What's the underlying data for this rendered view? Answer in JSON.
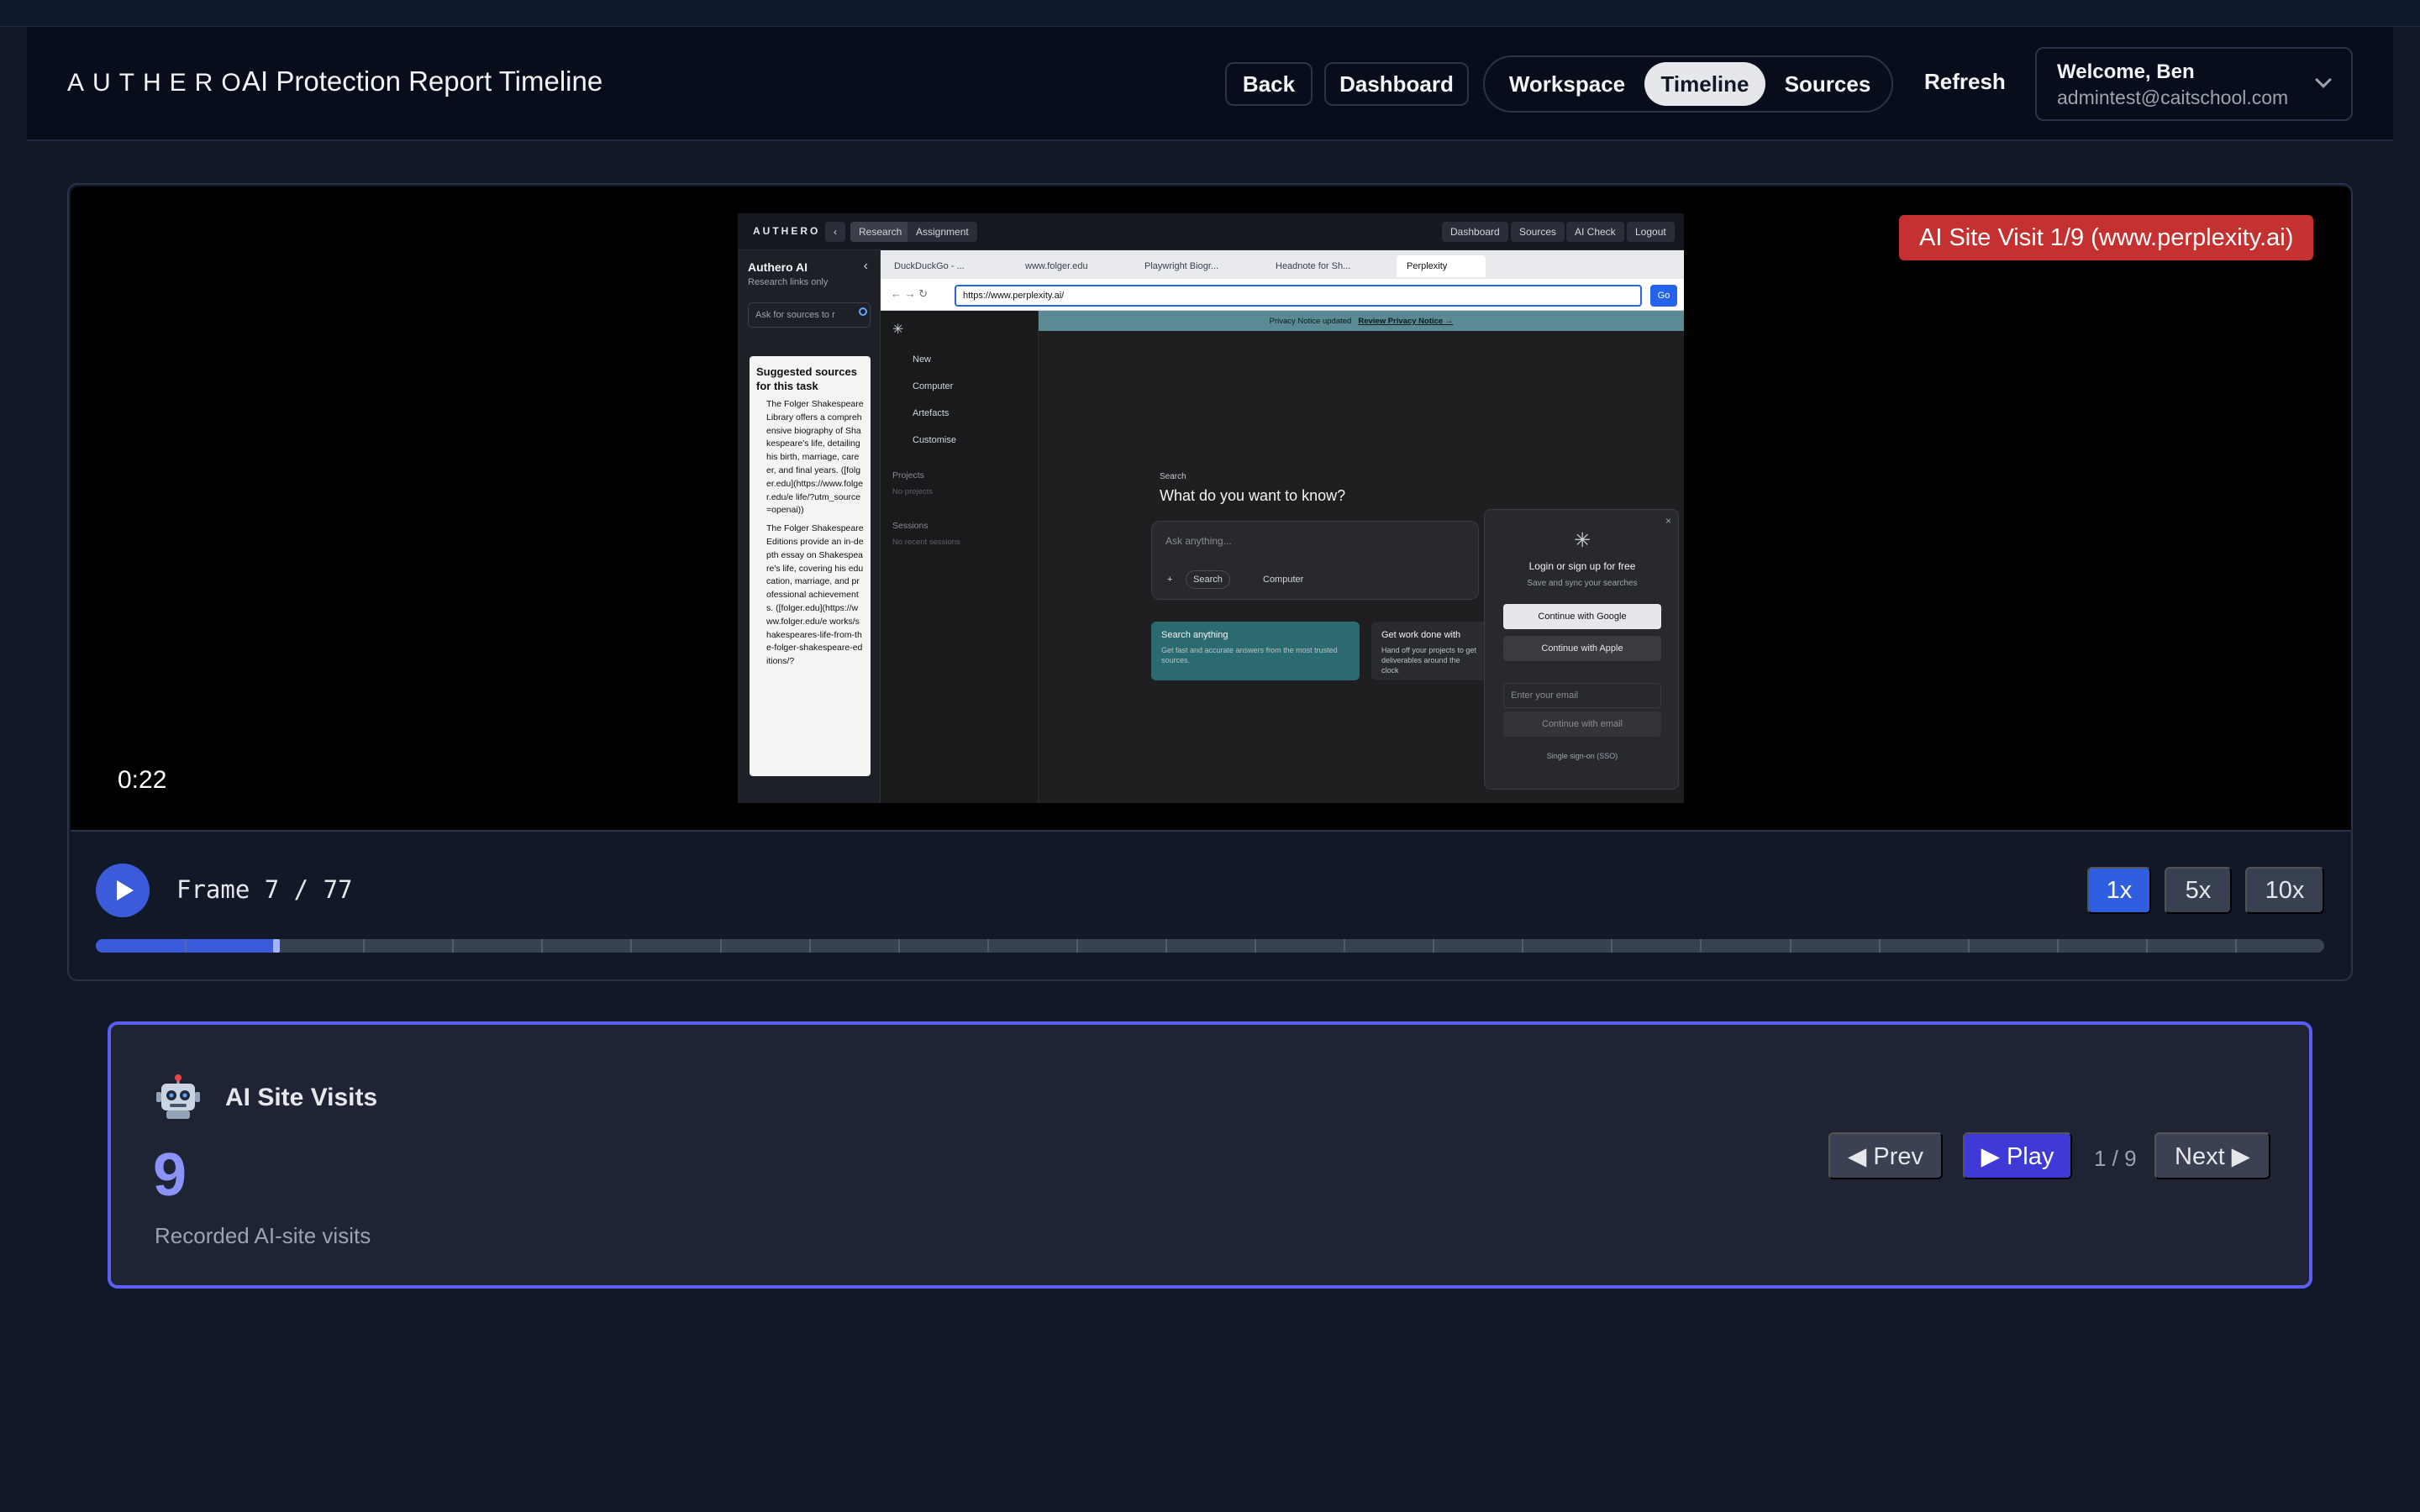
{
  "header": {
    "logo": "AUTHERO",
    "title": "AI Protection Report Timeline",
    "buttons": {
      "back": "Back",
      "dashboard": "Dashboard",
      "refresh": "Refresh"
    },
    "tabs": [
      {
        "label": "Workspace",
        "active": false
      },
      {
        "label": "Timeline",
        "active": true
      },
      {
        "label": "Sources",
        "active": false
      }
    ],
    "user": {
      "name": "Welcome, Ben",
      "email": "admintest@caitschool.com"
    }
  },
  "player": {
    "timestamp": "0:22",
    "ai_badge": "AI Site Visit 1/9 (www.perplexity.ai)",
    "frame_label": "Frame 7 / 77",
    "current_frame": 7,
    "total_frames": 77,
    "speeds": [
      {
        "label": "1x",
        "active": true
      },
      {
        "label": "5x",
        "active": false
      },
      {
        "label": "10x",
        "active": false
      }
    ],
    "colors": {
      "accent": "#3b5bdb",
      "badge": "#c53030"
    }
  },
  "screenshot": {
    "logo": "AUTHERO",
    "top_chips": [
      "Research",
      "Assignment"
    ],
    "top_right_chips": [
      "Dashboard",
      "Sources",
      "AI Check",
      "Logout"
    ],
    "sidebar": {
      "title": "Authero AI",
      "subtitle": "Research links only",
      "search_placeholder": "Ask for sources to r",
      "card_title": "Suggested sources for this task",
      "card_text_1": "The Folger Shakespeare Library offers a comprehensive biography of Shakespeare's life, detailing his birth, marriage, career, and final years. ([folger.edu](https://www.folger.edu/e life/?utm_source=openai))",
      "card_text_2": "The Folger Shakespeare Editions provide an in-depth essay on Shakespeare's life, covering his education, marriage, and professional achievements. ([folger.edu](https://www.folger.edu/e works/shakespeares-life-from-the-folger-shakespeare-editions/?"
    },
    "tabs": [
      "DuckDuckGo - ...",
      "www.folger.edu",
      "Playwright Biogr...",
      "Headnote for Sh...",
      "Perplexity"
    ],
    "url": "https://www.perplexity.ai/",
    "go": "Go",
    "perplexity": {
      "nav": [
        "New",
        "Computer",
        "Artefacts",
        "Customise"
      ],
      "projects": "Projects",
      "no_projects": "No projects",
      "sessions": "Sessions",
      "no_sessions": "No recent sessions",
      "notice": "Privacy Notice updated",
      "notice_link": "Review Privacy Notice →",
      "search_label": "Search",
      "question": "What do you want to know?",
      "ask_placeholder": "Ask anything...",
      "pill_search": "Search",
      "pill_computer": "Computer",
      "sugg1_title": "Search anything",
      "sugg1_desc": "Get fast and accurate answers from the most trusted sources.",
      "sugg2_title": "Get work done with",
      "sugg2_desc": "Hand off your projects to get deliverables around the clock",
      "modal_title": "Login or sign up for free",
      "modal_sub": "Save and sync your searches",
      "google": "Continue with Google",
      "apple": "Continue with Apple",
      "email_placeholder": "Enter your email",
      "continue_email": "Continue with email",
      "sso": "Single sign-on (SSO)"
    }
  },
  "panel": {
    "icon": "robot-icon",
    "title": "AI Site Visits",
    "count": "9",
    "subtitle": "Recorded AI-site visits",
    "prev": "◀ Prev",
    "play": "▶ Play",
    "page": "1 / 9",
    "next": "Next ▶",
    "colors": {
      "border": "#5b5ef0",
      "count": "#8b93f8"
    }
  }
}
